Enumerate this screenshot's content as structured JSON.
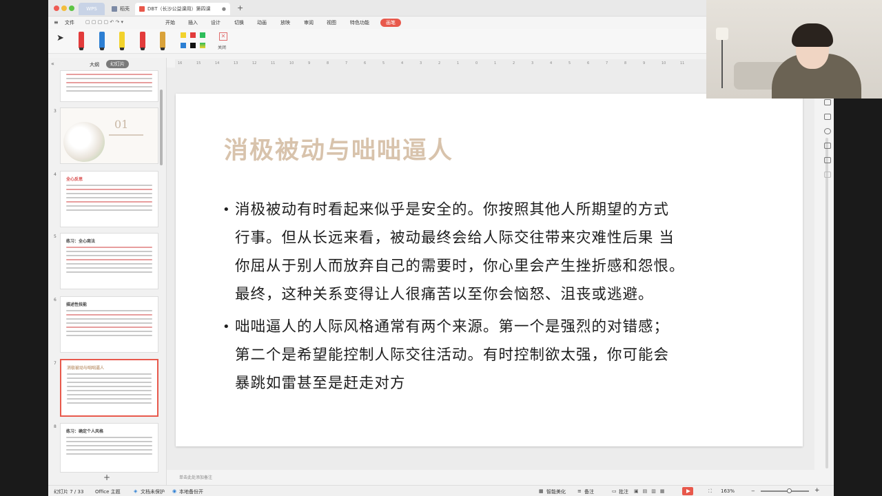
{
  "titlebar": {
    "tabs": [
      {
        "label": "WPS"
      },
      {
        "label": "稻壳"
      },
      {
        "label": "DBT（长沙公益课用）第四课"
      }
    ],
    "add_tab": "+"
  },
  "menu": {
    "items": [
      "文件",
      "开始",
      "插入",
      "设计",
      "切换",
      "动画",
      "放映",
      "审阅",
      "视图",
      "特色功能"
    ],
    "active": "画笔"
  },
  "pen_toolbar": {
    "pen_colors": [
      "#e23b3b",
      "#2d7fd3",
      "#f2d22c",
      "#e23b3b",
      "#d9a23a"
    ],
    "swatches": [
      "#f2d22c",
      "#e23b3b",
      "#2dbd5a",
      "#2d7fd3",
      "#111111",
      "#2dbd5a"
    ],
    "close_label": "关闭"
  },
  "panel": {
    "outline_label": "大纲",
    "slides_label": "幻灯片",
    "thumbnails": [
      {
        "num": "3",
        "title": "01"
      },
      {
        "num": "4",
        "title": "全心反思"
      },
      {
        "num": "5",
        "title": "练习：全心商法"
      },
      {
        "num": "6",
        "title": "描述性技能"
      },
      {
        "num": "7",
        "title": "消极被动与咄咄逼人"
      },
      {
        "num": "8",
        "title": "练习：确定个人风格"
      }
    ],
    "add_slide": "+"
  },
  "ruler": [
    "16",
    "15",
    "14",
    "13",
    "12",
    "11",
    "10",
    "9",
    "8",
    "7",
    "6",
    "5",
    "4",
    "3",
    "2",
    "1",
    "0",
    "1",
    "2",
    "3",
    "4",
    "5",
    "6",
    "7",
    "8",
    "9",
    "10",
    "11"
  ],
  "slide": {
    "title": "消极被动与咄咄逼人",
    "bullets": [
      {
        "dot": "•",
        "lines": [
          "消极被动有时看起来似乎是安全的。你按照其他人所期望的方式",
          "行事。但从长远来看，被动最终会给人际交往带来灾难性后果 当",
          "你屈从于别人而放弃自己的需要时，你心里会产生挫折感和怨恨。",
          "最终，这种关系变得让人很痛苦以至你会恼怒、沮丧或逃避。"
        ]
      },
      {
        "dot": "•",
        "lines": [
          "咄咄逼人的人际风格通常有两个来源。第一个是强烈的对错感；",
          "第二个是希望能控制人际交往活动。有时控制欲太强，你可能会",
          "暴跳如雷甚至是赶走对方"
        ]
      }
    ]
  },
  "notes_placeholder": "单击此处添加备注",
  "status": {
    "slide_counter": "幻灯片 7 / 33",
    "theme": "Office 主题",
    "doc_protect": "文档未保护",
    "backup": "本地备份开",
    "beautify": "智能美化",
    "notes": "备注",
    "comments": "批注",
    "zoom": "163%"
  }
}
